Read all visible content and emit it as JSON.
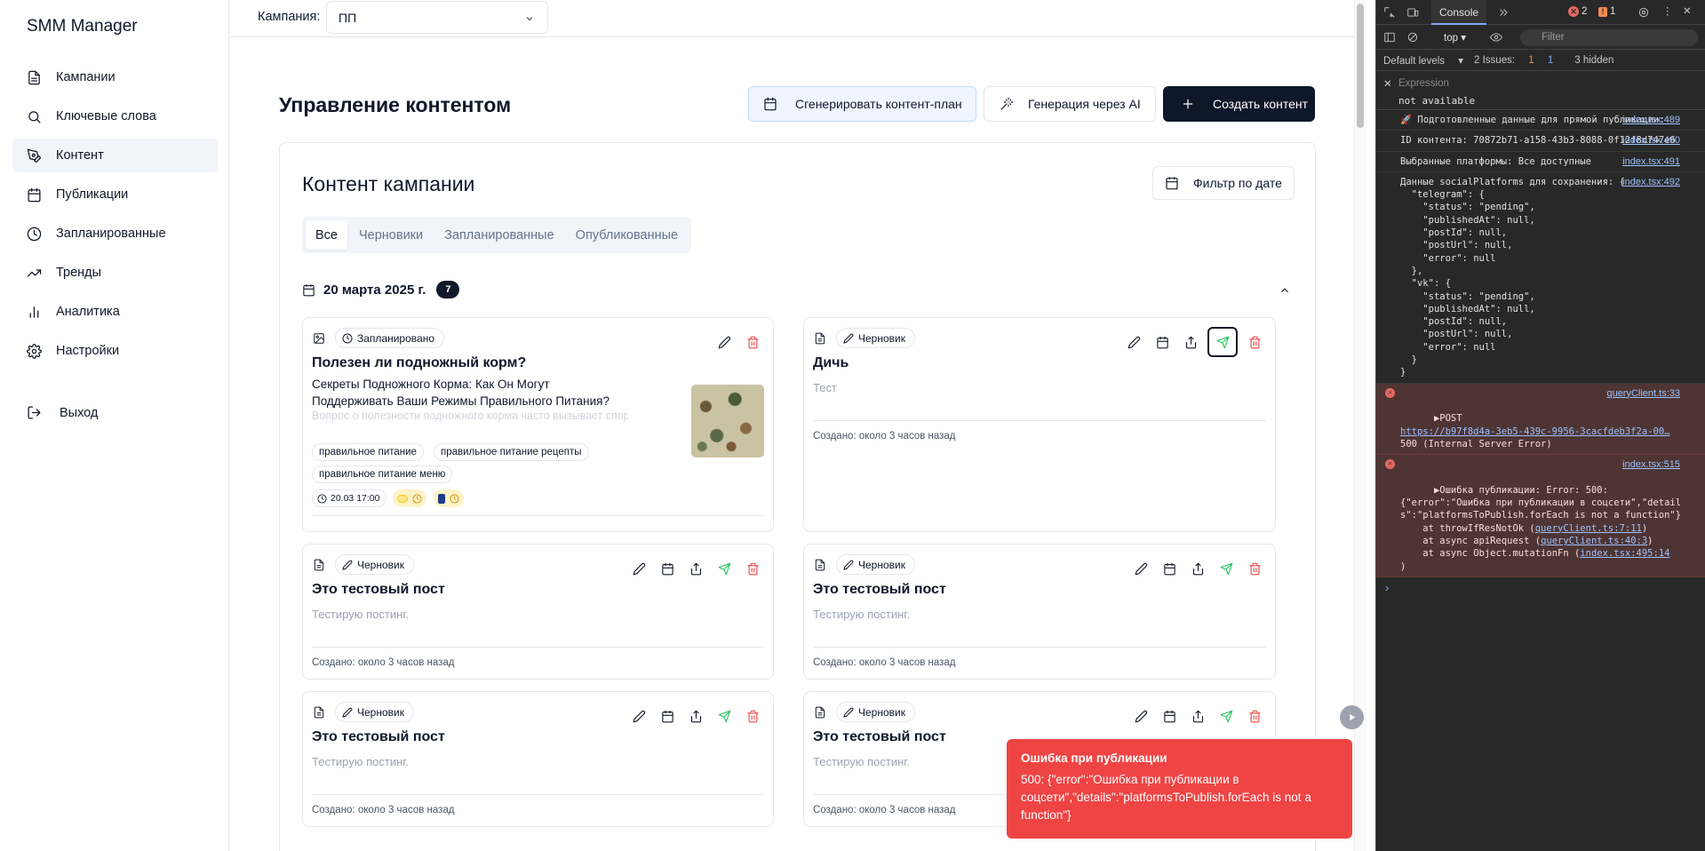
{
  "sidebar": {
    "brand": "SMM Manager",
    "items": [
      {
        "label": "Кампании",
        "icon": "document-icon"
      },
      {
        "label": "Ключевые слова",
        "icon": "search-icon"
      },
      {
        "label": "Контент",
        "icon": "pen-icon",
        "active": true
      },
      {
        "label": "Публикации",
        "icon": "calendar-icon"
      },
      {
        "label": "Запланированные",
        "icon": "clock-icon"
      },
      {
        "label": "Тренды",
        "icon": "trend-icon"
      },
      {
        "label": "Аналитика",
        "icon": "bar-chart-icon"
      },
      {
        "label": "Настройки",
        "icon": "gear-icon"
      }
    ],
    "logout": "Выход"
  },
  "topbar": {
    "campaign_label": "Кампания:",
    "campaign_value": "ПП"
  },
  "page": {
    "title": "Управление контентом",
    "btn_plan": "Сгенерировать контент-план",
    "btn_ai": "Генерация через AI",
    "btn_create": "Создать контент"
  },
  "panel": {
    "title": "Контент кампании",
    "date_filter": "Фильтр по дате",
    "tabs": [
      "Все",
      "Черновики",
      "Запланированные",
      "Опубликованные"
    ],
    "group_date": "20 марта 2025 г.",
    "group_count": "7"
  },
  "cards": {
    "c1": {
      "status": "Запланировано",
      "title": "Полезен ли подножный корм?",
      "subtitle": "Секреты Подножного Корма: Как Он Могут Поддерживать Ваши Режимы Правильного Питания?",
      "faded": "Вопрос о полезности подножного корма часто вызывает споры. С",
      "tags": [
        "правильное питание",
        "правильное питание рецепты",
        "правильное питание меню"
      ],
      "time": "20.03 17:00"
    },
    "c2": {
      "status": "Черновик",
      "title": "Дичь",
      "preview": "Тест",
      "created": "Создано: около 3 часов назад"
    },
    "c3": {
      "status": "Черновик",
      "title": "Это тестовый пост",
      "preview": "Тестирую постинг.",
      "created": "Создано: около 3 часов назад"
    },
    "c4": {
      "status": "Черновик",
      "title": "Это тестовый пост",
      "preview": "Тестирую постинг.",
      "created": "Создано: около 3 часов назад"
    },
    "c5": {
      "status": "Черновик",
      "title": "Это тестовый пост",
      "preview": "Тестирую постинг.",
      "created": "Создано: около 3 часов назад"
    },
    "c6": {
      "status": "Черновик",
      "title": "Это тестовый пост",
      "preview": "Тестирую постинг.",
      "created": "Создано: около 3 часов назад"
    }
  },
  "toast": {
    "title": "Ошибка при публикации",
    "body": "500: {\"error\":\"Ошибка при публикации в соцсети\",\"details\":\"platformsToPublish.forEach is not a function\"}"
  },
  "devtools": {
    "tab": "Console",
    "errors": "2",
    "warnings": "1",
    "context": "top",
    "filter_placeholder": "Filter",
    "levels": "Default levels",
    "issues": "2 Issues:",
    "issues_warn": "1",
    "issues_info": "1",
    "hidden": "3 hidden",
    "expression_label": "Expression",
    "expression_value": "not available",
    "messages": [
      {
        "text": "🚀 Подготовленные данные для прямой публикации:",
        "src": "index.tsx:489"
      },
      {
        "text": "ID контента: 70872b71-a158-43b3-8088-0f12f8d747e6",
        "src": "index.tsx:490"
      },
      {
        "text": "Выбранные платформы: Все доступные",
        "src": "index.tsx:491"
      },
      {
        "text": "Данные socialPlatforms для сохранения: {\n  \"telegram\": {\n    \"status\": \"pending\",\n    \"publishedAt\": null,\n    \"postId\": null,\n    \"postUrl\": null,\n    \"error\": null\n  },\n  \"vk\": {\n    \"status\": \"pending\",\n    \"publishedAt\": null,\n    \"postId\": null,\n    \"postUrl\": null,\n    \"error\": null\n  }\n}",
        "src": "index.tsx:492"
      }
    ],
    "error1": {
      "method": "▶POST",
      "src": "queryClient.ts:33",
      "url": "https://b97f8d4a-3eb5-439c-9956-3cacfdeb3f2a-00…",
      "status": "500 (Internal Server Error)"
    },
    "error2": {
      "head": "▶Ошибка публикации: Error: 500:",
      "src": "index.tsx:515",
      "body": "{\"error\":\"Ошибка при публикации в соцсети\",\"details\":\"platformsToPublish.forEach is not a function\"}",
      "at1_pre": "    at throwIfResNotOk (",
      "at1_link": "queryClient.ts:7:11",
      "at2_pre": "    at async apiRequest (",
      "at2_link": "queryClient.ts:40:3",
      "at3_pre": "    at async Object.mutationFn (",
      "at3_link": "index.tsx:495:14",
      "close": ")"
    }
  }
}
